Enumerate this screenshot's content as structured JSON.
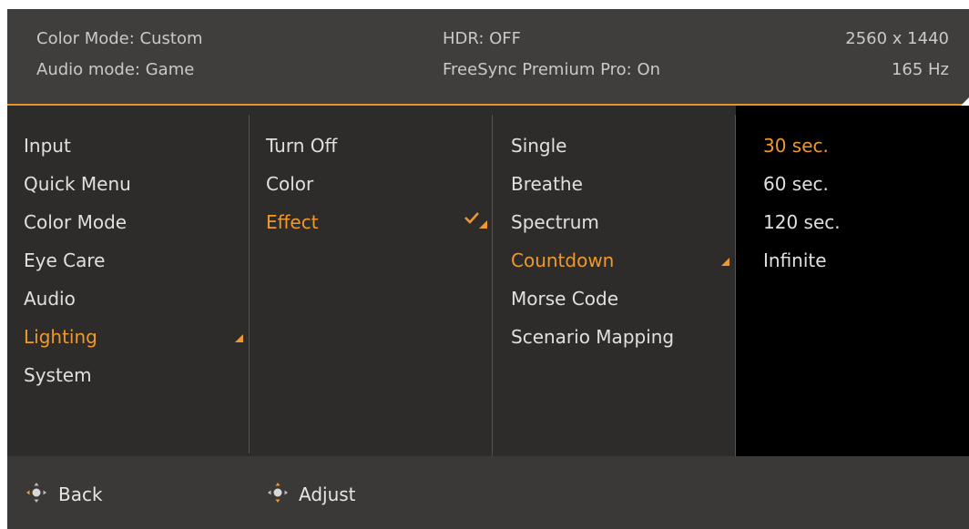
{
  "header": {
    "color_mode": "Color Mode: Custom",
    "audio_mode": "Audio mode: Game",
    "hdr": "HDR: OFF",
    "freesync": "FreeSync Premium Pro: On",
    "resolution": "2560 x 1440",
    "refresh_rate": "165 Hz"
  },
  "main_menu": {
    "items": [
      "Input",
      "Quick Menu",
      "Color Mode",
      "Eye Care",
      "Audio",
      "Lighting",
      "System"
    ],
    "selected": "Lighting"
  },
  "lighting_menu": {
    "items": [
      "Turn Off",
      "Color",
      "Effect"
    ],
    "selected": "Effect"
  },
  "effect_menu": {
    "items": [
      "Single",
      "Breathe",
      "Spectrum",
      "Countdown",
      "Morse Code",
      "Scenario Mapping"
    ],
    "selected": "Countdown"
  },
  "countdown_menu": {
    "items": [
      "30 sec.",
      "60 sec.",
      "120 sec.",
      "Infinite"
    ],
    "selected": "30 sec."
  },
  "footer": {
    "back_label": "Back",
    "adjust_label": "Adjust"
  },
  "colors": {
    "accent": "#f0982c",
    "background": "#2d2c2a",
    "header_bg": "#403e3c"
  },
  "icons": {
    "back": "joystick-nav-icon",
    "adjust": "joystick-adjust-icon",
    "check": "check-icon"
  }
}
